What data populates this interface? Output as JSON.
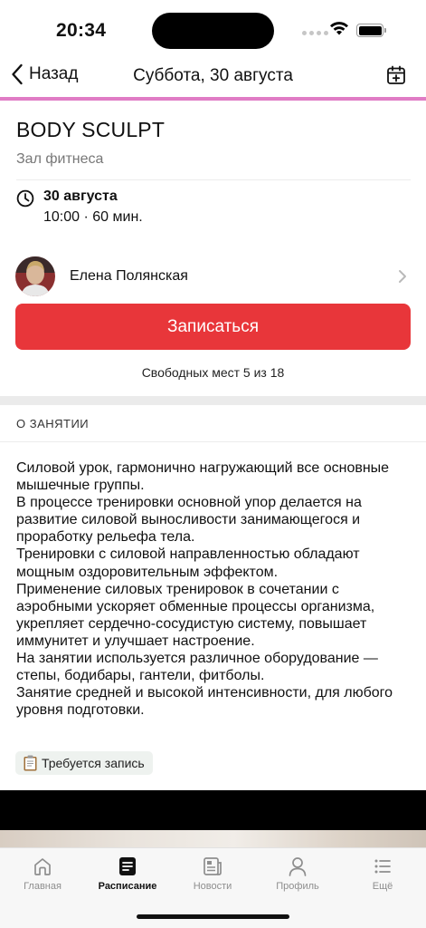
{
  "status_bar": {
    "time": "20:34"
  },
  "nav": {
    "back_label": "Назад",
    "title": "Суббота, 30 августа"
  },
  "class": {
    "title": "BODY SCULPT",
    "location": "Зал фитнеса",
    "date": "30 августа",
    "time_duration": "10:00 · 60 мин."
  },
  "trainer": {
    "name": "Елена Полянская"
  },
  "signup": {
    "button_label": "Записаться",
    "slots_text": "Свободных мест 5 из 18"
  },
  "about": {
    "header": "О ЗАНЯТИИ",
    "paragraphs": [
      "Силовой урок, гармонично нагружающий все основные мышечные группы.",
      "В процессе тренировки основной упор делается на развитие силовой выносливости занимающегося и проработку рельефа тела.",
      "Тренировки с силовой направленностью обладают мощным оздоровительным эффектом.",
      "Применение силовых тренировок в сочетании с аэробными ускоряет обменные процессы организма, укрепляет сердечно-сосудистую систему, повышает иммунитет и улучшает настроение.",
      "На занятии используется различное оборудование — степы, бодибары, гантели, фитболы.",
      "Занятие средней и высокой интенсивности, для любого уровня подготовки."
    ]
  },
  "tag": {
    "icon": "clipboard-icon",
    "label": "Требуется запись"
  },
  "tab_bar": {
    "items": [
      {
        "label": "Главная",
        "icon": "home-icon",
        "active": false
      },
      {
        "label": "Расписание",
        "icon": "schedule-icon",
        "active": true
      },
      {
        "label": "Новости",
        "icon": "news-icon",
        "active": false
      },
      {
        "label": "Профиль",
        "icon": "profile-icon",
        "active": false
      },
      {
        "label": "Ещё",
        "icon": "more-icon",
        "active": false
      }
    ]
  },
  "colors": {
    "accent_line": "#e07cc5",
    "signup_button": "#e8363a",
    "tag_background": "#eef2ef"
  }
}
